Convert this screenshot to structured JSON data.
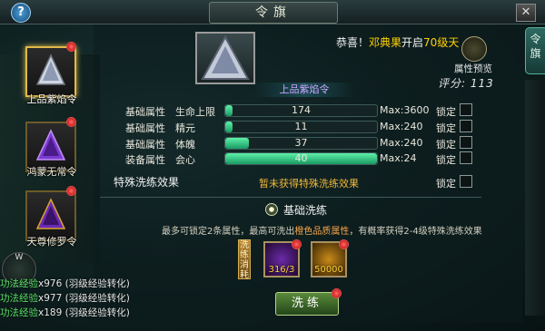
{
  "window": {
    "title": "令旗",
    "help_label": "?",
    "close_label": "✕",
    "side_tab_label": "令旗"
  },
  "flags": [
    {
      "label": "上品紫焰令",
      "selected": true
    },
    {
      "label": "鸿蒙无常令",
      "selected": false
    },
    {
      "label": "天尊修罗令",
      "selected": false
    }
  ],
  "minimap": {
    "label": "W"
  },
  "log": [
    {
      "prefix": "功法经验",
      "text": "x976 (羽级经验转化)"
    },
    {
      "prefix": "功法经验",
      "text": "x977 (羽级经验转化)"
    },
    {
      "prefix": "功法经验",
      "text": "x189 (羽级经验转化)"
    }
  ],
  "item": {
    "name": "上品紫焰令"
  },
  "notice": {
    "prefix": "恭喜！",
    "player": "邓典果",
    "middle": "开启",
    "highlight": "70级天"
  },
  "preview": {
    "label": "属性预览",
    "icon": "preview-icon"
  },
  "score": {
    "label": "评分:",
    "value": "113"
  },
  "attributes": [
    {
      "category": "基础属性",
      "name": "生命上限",
      "value": "174",
      "max": "Max:3600",
      "fill": 0.048,
      "lock": "锁定"
    },
    {
      "category": "基础属性",
      "name": "精元",
      "value": "11",
      "max": "Max:240",
      "fill": 0.046,
      "lock": "锁定"
    },
    {
      "category": "基础属性",
      "name": "体魄",
      "value": "37",
      "max": "Max:240",
      "fill": 0.154,
      "lock": "锁定"
    },
    {
      "category": "装备属性",
      "name": "会心",
      "value": "40",
      "max": "Max:24",
      "fill": 1.0,
      "lock": "锁定"
    }
  ],
  "special": {
    "label": "特殊洗练效果",
    "value": "暂未获得特殊洗练效果",
    "lock": "锁定"
  },
  "basic_wash": {
    "label": "基础洗练"
  },
  "description": {
    "part1": "最多可锁定2条属性，最高可洗出",
    "highlight": "橙色品质属性",
    "part2": "，有概率获得2-4级特殊洗练效果"
  },
  "consume": {
    "label": "洗练消耗"
  },
  "resources": [
    {
      "count": "316/3",
      "icon": "purple-crystal-icon"
    },
    {
      "count": "50000",
      "icon": "gold-coin-icon"
    }
  ],
  "wash_button": {
    "label": "洗练"
  },
  "colors": {
    "accent_green": "#5ef0a8",
    "gold": "#ffd200",
    "purple": "#c9a7ff",
    "orange": "#f0b93a"
  }
}
